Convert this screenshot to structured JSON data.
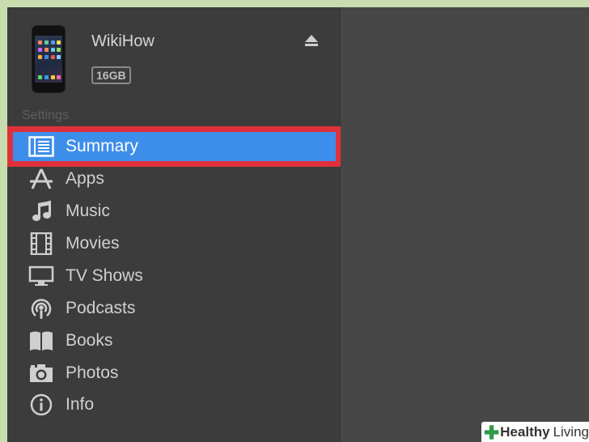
{
  "device": {
    "name": "WikiHow",
    "capacity": "16GB"
  },
  "sidebar": {
    "section_label": "Settings",
    "items": [
      {
        "label": "Summary",
        "icon": "summary-list-icon",
        "active": true
      },
      {
        "label": "Apps",
        "icon": "apps-icon",
        "active": false
      },
      {
        "label": "Music",
        "icon": "music-note-icon",
        "active": false
      },
      {
        "label": "Movies",
        "icon": "film-strip-icon",
        "active": false
      },
      {
        "label": "TV Shows",
        "icon": "tv-icon",
        "active": false
      },
      {
        "label": "Podcasts",
        "icon": "podcast-icon",
        "active": false
      },
      {
        "label": "Books",
        "icon": "book-icon",
        "active": false
      },
      {
        "label": "Photos",
        "icon": "camera-icon",
        "active": false
      },
      {
        "label": "Info",
        "icon": "info-icon",
        "active": false
      }
    ]
  },
  "watermark": {
    "word1": "Healthy",
    "word2": "Living"
  },
  "colors": {
    "selection": "#3d8eea",
    "highlight_border": "#e0303a",
    "watermark_cross": "#2e9a4a"
  }
}
